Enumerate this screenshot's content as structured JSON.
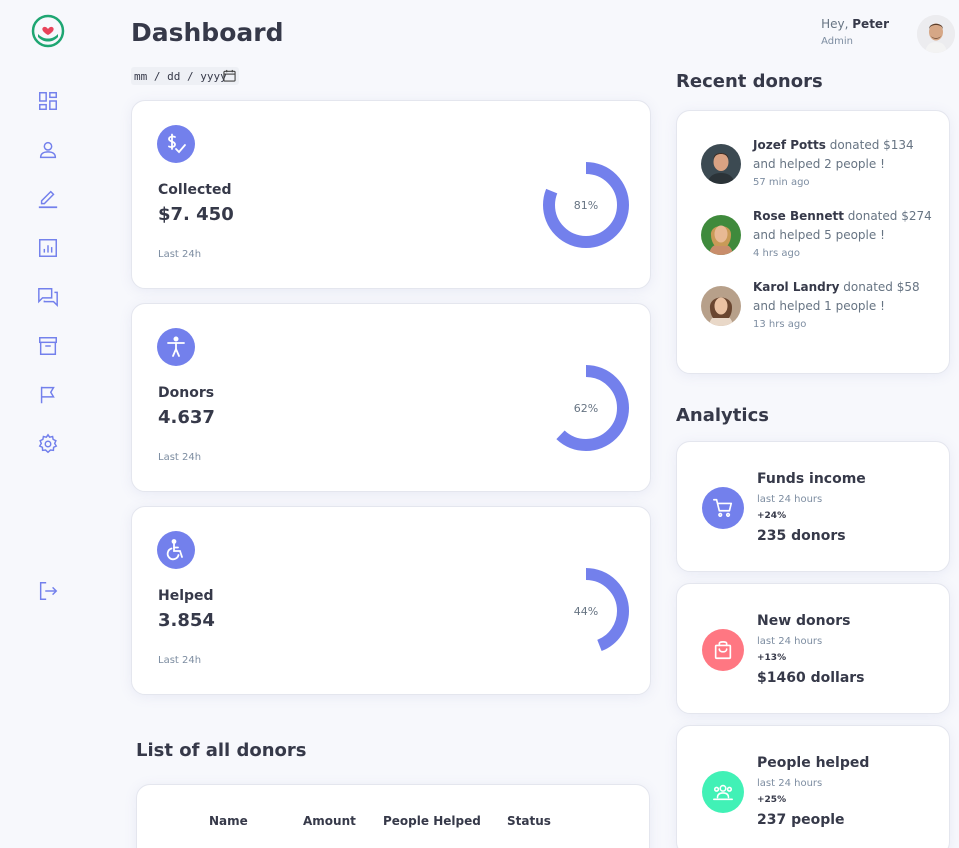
{
  "header": {
    "title": "Dashboard",
    "greeting": "Hey,",
    "user_name": "Peter",
    "role": "Admin",
    "date_placeholder": "mm / dd / yyyy"
  },
  "sidebar": {
    "items": [
      {
        "icon": "dashboard-icon"
      },
      {
        "icon": "person-icon"
      },
      {
        "icon": "edit-icon"
      },
      {
        "icon": "report-icon"
      },
      {
        "icon": "messages-icon"
      },
      {
        "icon": "archive-icon"
      },
      {
        "icon": "flag-icon"
      },
      {
        "icon": "settings-icon"
      },
      {
        "icon": "logout-icon"
      }
    ]
  },
  "stats": [
    {
      "label": "Collected",
      "value": "$7. 450",
      "footer": "Last 24h",
      "percent": 81,
      "percent_label": "81%"
    },
    {
      "label": "Donors",
      "value": "4.637",
      "footer": "Last 24h",
      "percent": 62,
      "percent_label": "62%"
    },
    {
      "label": "Helped",
      "value": "3.854",
      "footer": "Last 24h",
      "percent": 44,
      "percent_label": "44%"
    }
  ],
  "list": {
    "title": "List of all donors",
    "columns": [
      "Name",
      "Amount",
      "People Helped",
      "Status"
    ]
  },
  "recent": {
    "title": "Recent donors",
    "items": [
      {
        "name": "Jozef Potts",
        "action": "donated $134",
        "rest": "and helped 2 people !",
        "time": "57 min ago"
      },
      {
        "name": "Rose Bennett",
        "action": "donated $274",
        "rest": "and helped 5 people !",
        "time": "4 hrs ago"
      },
      {
        "name": "Karol Landry",
        "action": "donated $58",
        "rest": "and helped 1 people !",
        "time": "13 hrs ago"
      }
    ]
  },
  "analytics": {
    "title": "Analytics",
    "items": [
      {
        "title": "Funds income",
        "sub": "last 24 hours",
        "pct": "+24%",
        "value": "235 donors",
        "color": "#7380ec",
        "icon": "cart-icon"
      },
      {
        "title": "New donors",
        "sub": "last 24 hours",
        "pct": "+13%",
        "value": "$1460 dollars",
        "color": "#ff7782",
        "icon": "bag-icon"
      },
      {
        "title": "People helped",
        "sub": "last 24 hours",
        "pct": "+25%",
        "value": "237 people",
        "color": "#41f1b6",
        "icon": "group-icon"
      }
    ]
  },
  "colors": {
    "primary": "#7380ec",
    "danger": "#ff7782",
    "success": "#41f1b6",
    "brand": "#1ea672"
  }
}
